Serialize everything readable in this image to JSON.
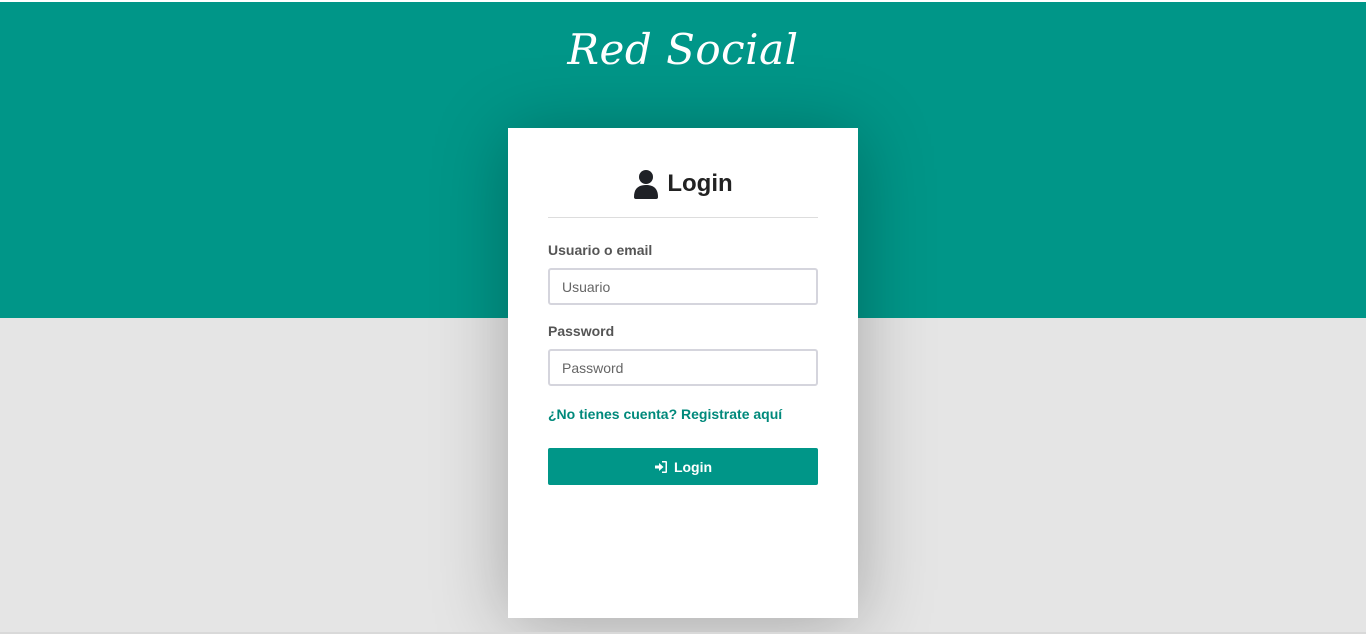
{
  "brand": {
    "title": "Red Social"
  },
  "login_card": {
    "title": "Login",
    "title_icon": "user-icon",
    "username": {
      "label": "Usuario o email",
      "placeholder": "Usuario",
      "value": ""
    },
    "password": {
      "label": "Password",
      "placeholder": "Password",
      "value": ""
    },
    "register_link": "¿No tienes cuenta? Registrate aquí",
    "submit": {
      "label": "Login",
      "icon": "log-in-icon"
    }
  },
  "colors": {
    "brand_teal": "#009688",
    "background_gray": "#e5e5e5",
    "card_white": "#ffffff",
    "link_teal": "#00897b"
  }
}
